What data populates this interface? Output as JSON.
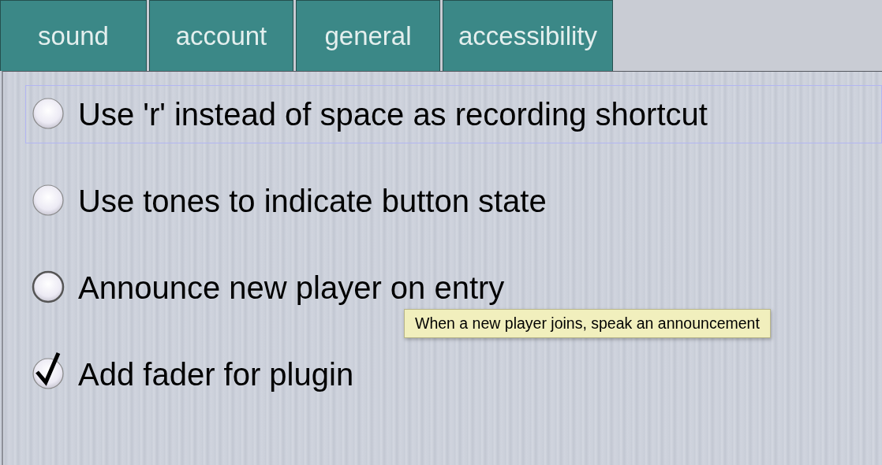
{
  "tabs": [
    {
      "label": "sound",
      "selected": false
    },
    {
      "label": "account",
      "selected": false
    },
    {
      "label": "general",
      "selected": false
    },
    {
      "label": "accessibility",
      "selected": false
    }
  ],
  "options": [
    {
      "label": "Use 'r' instead of space as recording shortcut",
      "checked": false,
      "focused": true,
      "hovered": false
    },
    {
      "label": "Use tones to indicate button state",
      "checked": false,
      "focused": false,
      "hovered": false
    },
    {
      "label": "Announce new player on entry",
      "checked": false,
      "focused": false,
      "hovered": true
    },
    {
      "label": "Add fader for plugin",
      "checked": true,
      "focused": false,
      "hovered": false
    }
  ],
  "tooltip": {
    "text": "When a new player joins, speak an announcement"
  }
}
